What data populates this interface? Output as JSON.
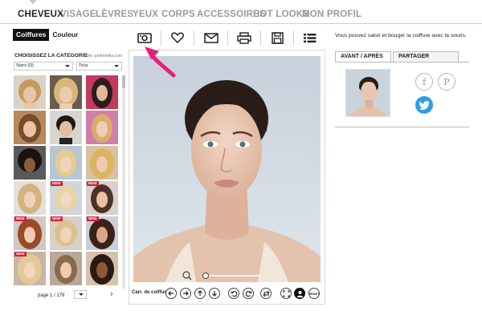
{
  "nav": {
    "items": [
      "CHEVEUX",
      "VISAGE",
      "LÈVRES",
      "YEUX",
      "CORPS",
      "ACCESSOIRES",
      "HOT LOOKS",
      "MON PROFIL"
    ]
  },
  "left_tabs": [
    "Coiffures",
    "Couleur"
  ],
  "category": {
    "label": "CHOISISSEZ LA CATEGORIE",
    "credit": "foto: profimedia.com",
    "select1": "Stars (D)",
    "select2": "Tous"
  },
  "thumbs": {
    "new_badge": "NEW"
  },
  "pager": {
    "text": "page 1 / 179"
  },
  "bottom": {
    "label": "Carr. de coiffure",
    "reset": "RESET"
  },
  "right": {
    "help": "Vous pouvez saisir et bouger la coiffure avec la souris.",
    "tab_active": "AVANT / APRÈS",
    "tab_share": "PARTAGER",
    "facebook": "f",
    "pinterest": "P"
  },
  "icons": [
    "camera-icon",
    "heart-icon",
    "mail-icon",
    "print-icon",
    "save-icon",
    "list-icon"
  ],
  "colors": {
    "accent_pink": "#e8207a",
    "twitter": "#2d9fe6",
    "badge": "#d6203b"
  }
}
